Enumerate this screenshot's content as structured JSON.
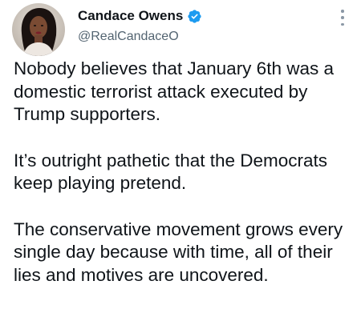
{
  "author": {
    "name": "Candace Owens",
    "handle": "@RealCandaceO",
    "verified": true,
    "badge_color": "#1d9bf0"
  },
  "icons": {
    "verified": "verified-badge-icon",
    "more": "more-vertical-icon"
  },
  "tweet": {
    "paragraphs": [
      "Nobody believes that January 6th was a domestic terrorist attack executed by Trump supporters.",
      "It’s outright pathetic that the Democrats keep playing pretend.",
      "The conservative movement grows every single day because with time, all of their lies and motives are uncovered."
    ]
  }
}
